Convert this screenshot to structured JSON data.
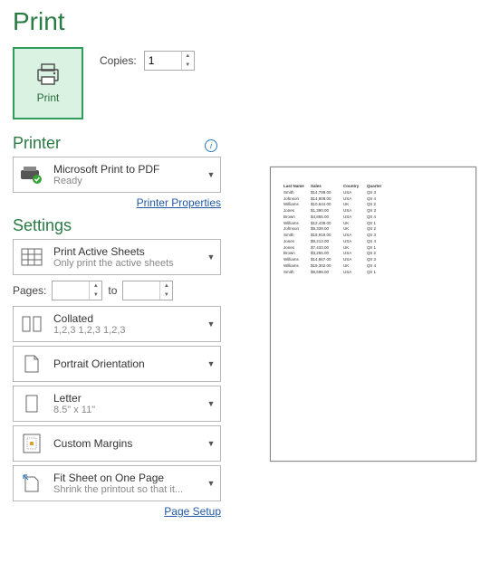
{
  "title": "Print",
  "print_button": "Print",
  "copies_label": "Copies:",
  "copies_value": "1",
  "printer_head": "Printer",
  "printer": {
    "name": "Microsoft Print to PDF",
    "status": "Ready"
  },
  "printer_props_link": "Printer Properties",
  "settings_head": "Settings",
  "settings": {
    "print_what": {
      "line1": "Print Active Sheets",
      "line2": "Only print the active sheets"
    },
    "pages_label": "Pages:",
    "pages_to": "to",
    "pages_from": "",
    "pages_to_val": "",
    "collate": {
      "line1": "Collated",
      "line2": "1,2,3    1,2,3    1,2,3"
    },
    "orientation": {
      "line1": "Portrait Orientation"
    },
    "paper": {
      "line1": "Letter",
      "line2": "8.5\" x 11\""
    },
    "margins": {
      "line1": "Custom Margins"
    },
    "scaling": {
      "line1": "Fit Sheet on One Page",
      "line2": "Shrink the printout so that it..."
    }
  },
  "page_setup_link": "Page Setup",
  "preview": {
    "headers": [
      "Last Name",
      "Sales",
      "Country",
      "Quarter"
    ],
    "rows": [
      [
        "Smith",
        "$14,799.00",
        "USA",
        "Qtr 3"
      ],
      [
        "Johnson",
        "$14,808.00",
        "USA",
        "Qtr 4"
      ],
      [
        "Williams",
        "$10,644.00",
        "UK",
        "Qtr 2"
      ],
      [
        "Jones",
        "$1,390.00",
        "USA",
        "Qtr 3"
      ],
      [
        "Brown",
        "$4,865.00",
        "USA",
        "Qtr 4"
      ],
      [
        "Williams",
        "$12,438.00",
        "UK",
        "Qtr 1"
      ],
      [
        "Johnson",
        "$9,339.00",
        "UK",
        "Qtr 2"
      ],
      [
        "Smith",
        "$18,919.00",
        "USA",
        "Qtr 3"
      ],
      [
        "Jones",
        "$9,213.00",
        "USA",
        "Qtr 4"
      ],
      [
        "Jones",
        "$7,433.00",
        "UK",
        "Qtr 1"
      ],
      [
        "Brown",
        "$3,255.00",
        "USA",
        "Qtr 2"
      ],
      [
        "Williams",
        "$14,867.00",
        "USA",
        "Qtr 3"
      ],
      [
        "Williams",
        "$19,302.00",
        "UK",
        "Qtr 4"
      ],
      [
        "Smith",
        "$9,698.00",
        "USA",
        "Qtr 1"
      ]
    ]
  }
}
